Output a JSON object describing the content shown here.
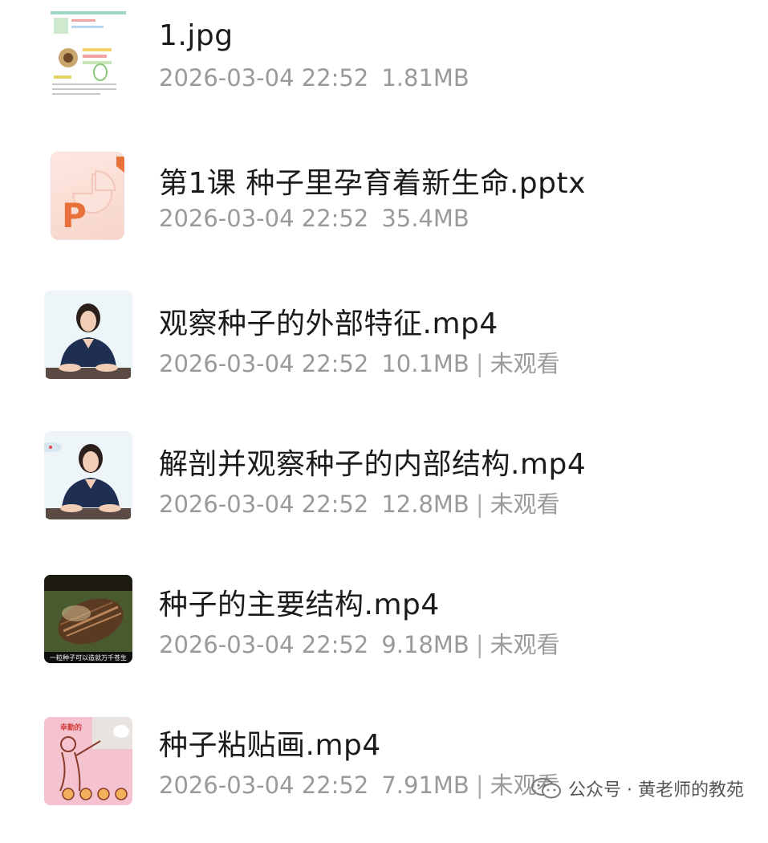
{
  "files": [
    {
      "name": "1.jpg",
      "date": "2026-03-04 22:52",
      "size": "1.81MB",
      "status": "",
      "thumb": "worksheet-thumbnail"
    },
    {
      "name": "第1课 种子里孕育着新生命.pptx",
      "date": "2026-03-04 22:52",
      "size": "35.4MB",
      "status": "",
      "thumb": "powerpoint-icon",
      "thumb_letter": "P"
    },
    {
      "name": "观察种子的外部特征.mp4",
      "date": "2026-03-04 22:52",
      "size": "10.1MB",
      "status": "未观看",
      "thumb": "teacher-video-thumbnail"
    },
    {
      "name": "解剖并观察种子的内部结构.mp4",
      "date": "2026-03-04 22:52",
      "size": "12.8MB",
      "status": "未观看",
      "thumb": "teacher-video-thumbnail"
    },
    {
      "name": "种子的主要结构.mp4",
      "date": "2026-03-04 22:52",
      "size": "9.18MB",
      "status": "未观看",
      "thumb": "seed-closeup-thumbnail",
      "thumb_caption": "一粒种子可以造就万千苍生"
    },
    {
      "name": "种子粘贴画.mp4",
      "date": "2026-03-04 22:52",
      "size": "7.91MB",
      "status": "未观看",
      "thumb": "seed-collage-thumbnail",
      "thumb_caption": "幸勤的"
    }
  ],
  "separator": "|",
  "watermark": {
    "text": "公众号 · 黄老师的教苑",
    "icon": "wechat-icon"
  },
  "colors": {
    "name": "#1b1b1b",
    "meta": "#9a9a9a",
    "ppt_orange": "#e8703a"
  }
}
